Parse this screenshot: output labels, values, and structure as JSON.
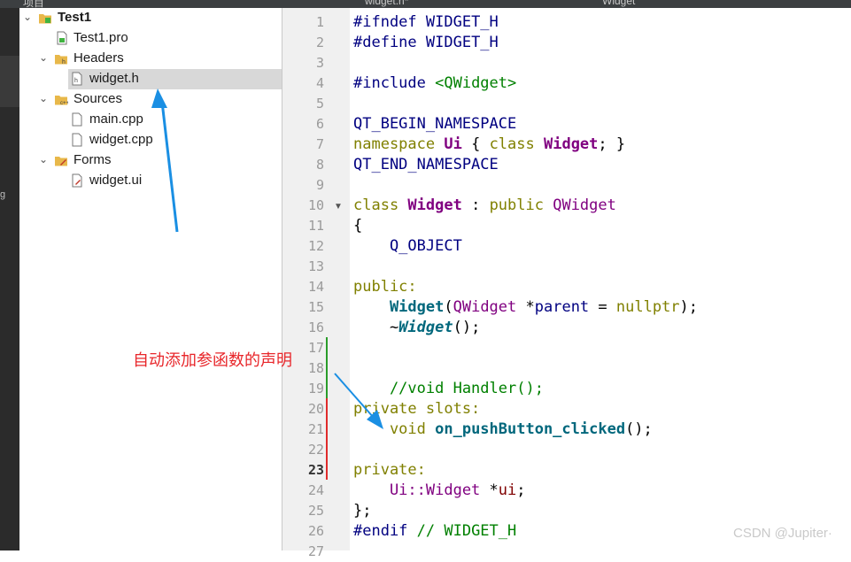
{
  "top_bar": {
    "left": "项目",
    "tab": "widget.h*",
    "right": "Widget"
  },
  "mode_bar": {
    "stub": "g"
  },
  "project_tree": {
    "root": "Test1",
    "items": [
      {
        "label": "Test1.pro",
        "icon": "pro-file-icon"
      },
      {
        "label": "Headers",
        "icon": "headers-folder-icon"
      },
      {
        "label": "widget.h",
        "icon": "header-file-icon"
      },
      {
        "label": "Sources",
        "icon": "sources-folder-icon"
      },
      {
        "label": "main.cpp",
        "icon": "cpp-file-icon"
      },
      {
        "label": "widget.cpp",
        "icon": "cpp-file-icon"
      },
      {
        "label": "Forms",
        "icon": "forms-folder-icon"
      },
      {
        "label": "widget.ui",
        "icon": "ui-file-icon"
      }
    ]
  },
  "editor": {
    "current_line": 23,
    "line_numbers": [
      "1",
      "2",
      "3",
      "4",
      "5",
      "6",
      "7",
      "8",
      "9",
      "10",
      "11",
      "12",
      "13",
      "14",
      "15",
      "16",
      "17",
      "18",
      "19",
      "20",
      "21",
      "22",
      "23",
      "24",
      "25",
      "26",
      "27"
    ],
    "code": {
      "l1a": "#ifndef",
      "l1b": " WIDGET_H",
      "l2a": "#define",
      "l2b": " WIDGET_H",
      "l4a": "#include",
      "l4b": " <QWidget>",
      "l6": "QT_BEGIN_NAMESPACE",
      "l7a": "namespace",
      "l7b": " Ui",
      "l7c": " { ",
      "l7d": "class",
      "l7e": " Widget",
      "l7f": "; }",
      "l8": "QT_END_NAMESPACE",
      "l10a": "class",
      "l10b": " Widget",
      "l10c": " : ",
      "l10d": "public",
      "l10e": " QWidget",
      "l11": "{",
      "l12": "    Q_OBJECT",
      "l14": "public:",
      "l15a": "    Widget",
      "l15b": "(",
      "l15c": "QWidget",
      "l15d": " *",
      "l15e": "parent",
      "l15f": " = ",
      "l15g": "nullptr",
      "l15h": ");",
      "l16a": "    ~",
      "l16b": "Widget",
      "l16c": "();",
      "l19": "    //void Handler();",
      "l20": "private slots:",
      "l21a": "    void",
      "l21b": " on_pushButton_clicked",
      "l21c": "();",
      "l23": "private:",
      "l24a": "    Ui::Widget",
      "l24b": " *",
      "l24c": "ui",
      "l24d": ";",
      "l25": "};",
      "l26a": "#endif",
      "l26b": " // WIDGET_H"
    }
  },
  "annotation": "自动添加参函数的声明",
  "watermark": "CSDN @Jupiter·",
  "colors": {
    "annotation": "#e8262a",
    "arrow": "#1a8fe3",
    "added_marker": "#2a9d2a",
    "modified_marker": "#e02b2b"
  }
}
